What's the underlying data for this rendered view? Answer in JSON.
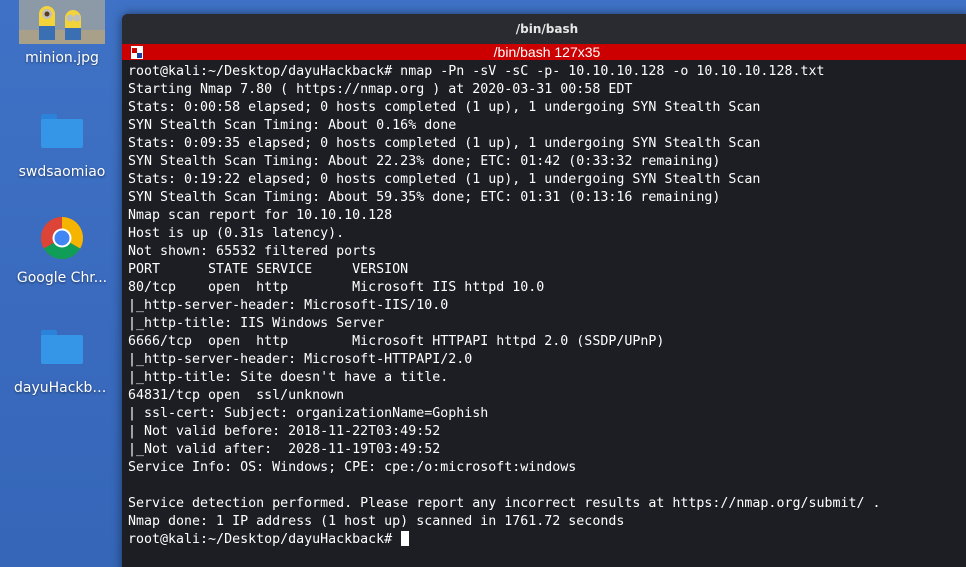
{
  "desktop": {
    "icons": [
      {
        "label": "minion.jpg",
        "icon": "image-thumbnail-icon"
      },
      {
        "label": "swdsaomiao",
        "icon": "folder-icon"
      },
      {
        "label": "Google Chr...",
        "icon": "chrome-icon"
      },
      {
        "label": "dayuHackba...",
        "icon": "folder-icon"
      }
    ]
  },
  "window": {
    "title": "/bin/bash",
    "tab_title": "/bin/bash 127x35",
    "tab_color": "#cc0000",
    "background": "#1d1e23"
  },
  "terminal": {
    "lines": [
      "root@kali:~/Desktop/dayuHackback# nmap -Pn -sV -sC -p- 10.10.10.128 -o 10.10.10.128.txt",
      "Starting Nmap 7.80 ( https://nmap.org ) at 2020-03-31 00:58 EDT",
      "Stats: 0:00:58 elapsed; 0 hosts completed (1 up), 1 undergoing SYN Stealth Scan",
      "SYN Stealth Scan Timing: About 0.16% done",
      "Stats: 0:09:35 elapsed; 0 hosts completed (1 up), 1 undergoing SYN Stealth Scan",
      "SYN Stealth Scan Timing: About 22.23% done; ETC: 01:42 (0:33:32 remaining)",
      "Stats: 0:19:22 elapsed; 0 hosts completed (1 up), 1 undergoing SYN Stealth Scan",
      "SYN Stealth Scan Timing: About 59.35% done; ETC: 01:31 (0:13:16 remaining)",
      "Nmap scan report for 10.10.10.128",
      "Host is up (0.31s latency).",
      "Not shown: 65532 filtered ports",
      "PORT      STATE SERVICE     VERSION",
      "80/tcp    open  http        Microsoft IIS httpd 10.0",
      "|_http-server-header: Microsoft-IIS/10.0",
      "|_http-title: IIS Windows Server",
      "6666/tcp  open  http        Microsoft HTTPAPI httpd 2.0 (SSDP/UPnP)",
      "|_http-server-header: Microsoft-HTTPAPI/2.0",
      "|_http-title: Site doesn't have a title.",
      "64831/tcp open  ssl/unknown",
      "| ssl-cert: Subject: organizationName=Gophish",
      "| Not valid before: 2018-11-22T03:49:52",
      "|_Not valid after:  2028-11-19T03:49:52",
      "Service Info: OS: Windows; CPE: cpe:/o:microsoft:windows",
      "",
      "Service detection performed. Please report any incorrect results at https://nmap.org/submit/ .",
      "Nmap done: 1 IP address (1 host up) scanned in 1761.72 seconds"
    ],
    "prompt": "root@kali:~/Desktop/dayuHackback# "
  }
}
